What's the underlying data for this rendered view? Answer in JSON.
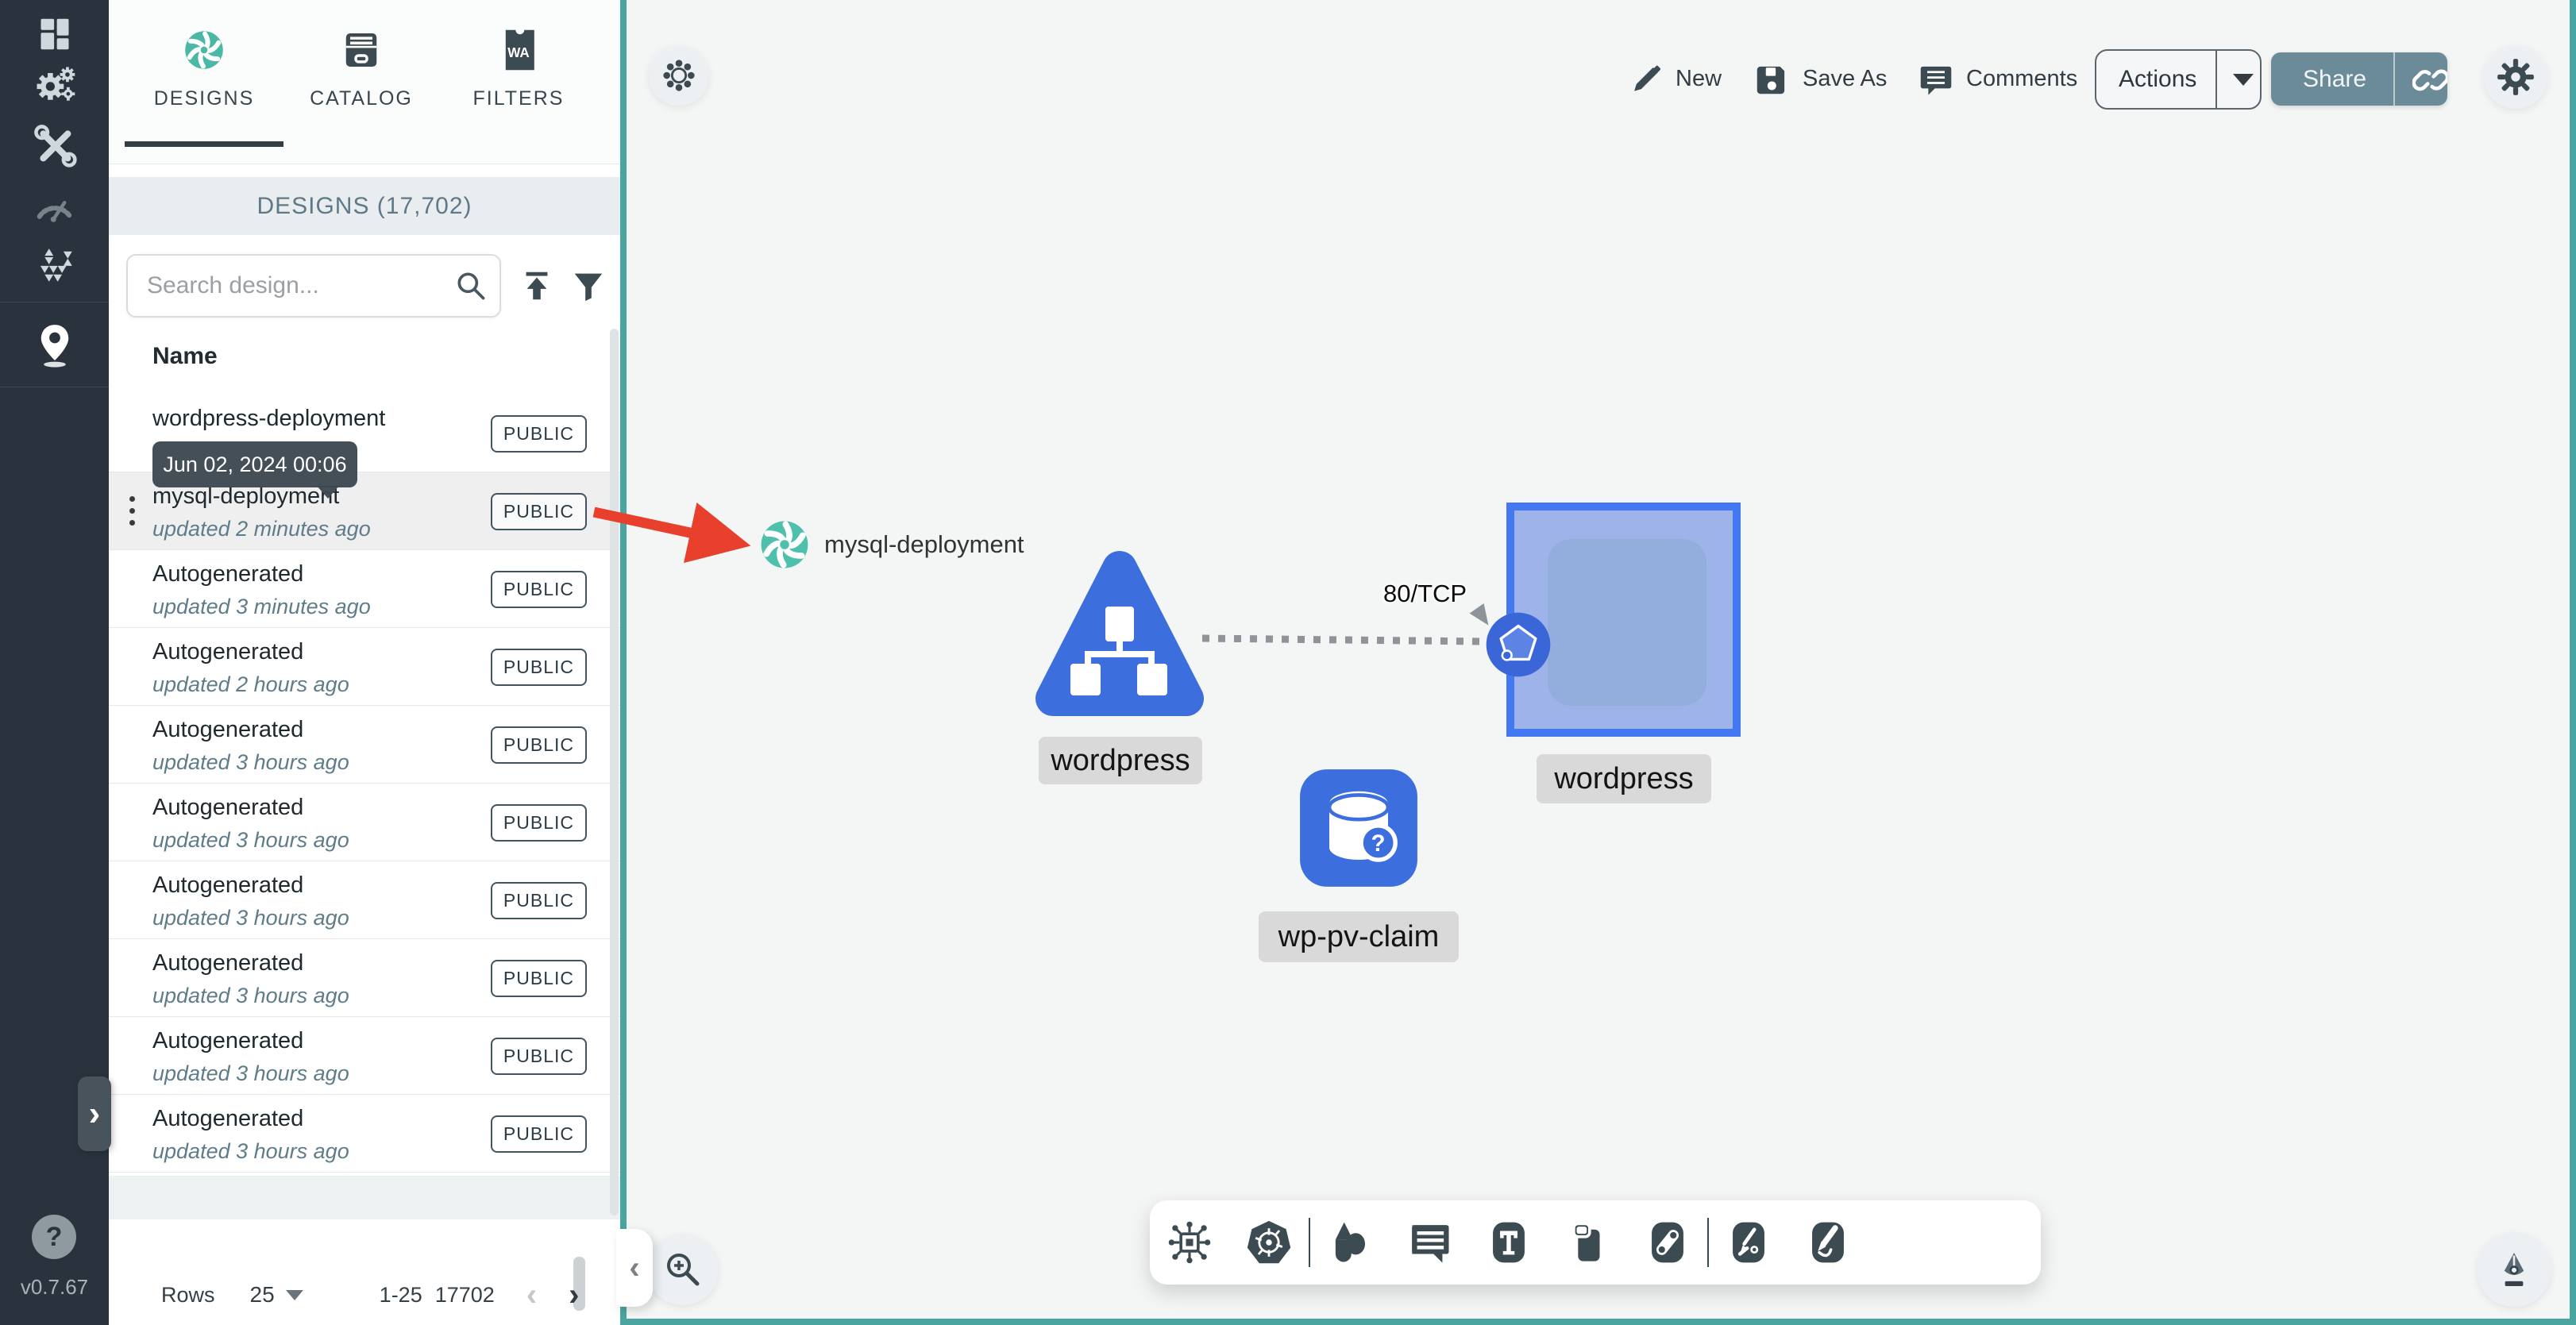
{
  "app": {
    "version": "v0.7.67"
  },
  "left_nav": {
    "items": [
      {
        "name": "dashboard"
      },
      {
        "name": "lifecycle"
      },
      {
        "name": "configuration"
      },
      {
        "name": "performance"
      },
      {
        "name": "extensions"
      },
      {
        "name": "visualize"
      }
    ],
    "help_label": "?"
  },
  "sidebar": {
    "tabs": [
      {
        "label": "DESIGNS",
        "active": true
      },
      {
        "label": "CATALOG",
        "active": false
      },
      {
        "label": "FILTERS",
        "active": false,
        "icon_text": "WA"
      }
    ],
    "panel_title": "DESIGNS (17,702)",
    "search": {
      "placeholder": "Search design..."
    },
    "columns": {
      "name": "Name"
    },
    "rows": [
      {
        "name": "wordpress-deployment",
        "updated": "",
        "badge": "PUBLIC",
        "selected": false
      },
      {
        "name": "mysql-deployment",
        "updated": "updated 2 minutes ago",
        "badge": "PUBLIC",
        "selected": true
      },
      {
        "name": "Autogenerated",
        "updated": "updated 3 minutes ago",
        "badge": "PUBLIC",
        "selected": false
      },
      {
        "name": "Autogenerated",
        "updated": "updated 2 hours ago",
        "badge": "PUBLIC",
        "selected": false
      },
      {
        "name": "Autogenerated",
        "updated": "updated 3 hours ago",
        "badge": "PUBLIC",
        "selected": false
      },
      {
        "name": "Autogenerated",
        "updated": "updated 3 hours ago",
        "badge": "PUBLIC",
        "selected": false
      },
      {
        "name": "Autogenerated",
        "updated": "updated 3 hours ago",
        "badge": "PUBLIC",
        "selected": false
      },
      {
        "name": "Autogenerated",
        "updated": "updated 3 hours ago",
        "badge": "PUBLIC",
        "selected": false
      },
      {
        "name": "Autogenerated",
        "updated": "updated 3 hours ago",
        "badge": "PUBLIC",
        "selected": false
      },
      {
        "name": "Autogenerated",
        "updated": "updated 3 hours ago",
        "badge": "PUBLIC",
        "selected": false
      }
    ],
    "tooltip": {
      "text": "Jun 02, 2024 00:06"
    },
    "pagination": {
      "rows_label": "Rows",
      "per_page": "25",
      "range": "1-25",
      "total": "17702",
      "prev": "‹",
      "next": "›"
    }
  },
  "toolbar_top": {
    "new_label": "New",
    "save_as_label": "Save As",
    "comments_label": "Comments",
    "actions_label": "Actions",
    "share_label": "Share"
  },
  "canvas": {
    "design_chip": {
      "label": "mysql-deployment"
    },
    "nodes": [
      {
        "id": "service-triangle",
        "label": "wordpress"
      },
      {
        "id": "deployment-square",
        "label": "wordpress"
      },
      {
        "id": "persistent-volume-claim",
        "label": "wp-pv-claim"
      }
    ],
    "edge": {
      "label": "80/TCP"
    }
  },
  "bottom_toolbar": {
    "icons": [
      "module",
      "kubernetes",
      "shapes",
      "comment",
      "text",
      "rectangles",
      "link",
      "pen-arrow",
      "pencil-draw"
    ]
  },
  "colors": {
    "accent_teal": "#4aa5a0",
    "node_blue": "#3d6ede",
    "square_border": "#4478f2",
    "square_fill": "#9db3ea",
    "share_button": "#6b8b99",
    "arrow_red": "#e8402c",
    "nav_bg": "#2a333d"
  }
}
